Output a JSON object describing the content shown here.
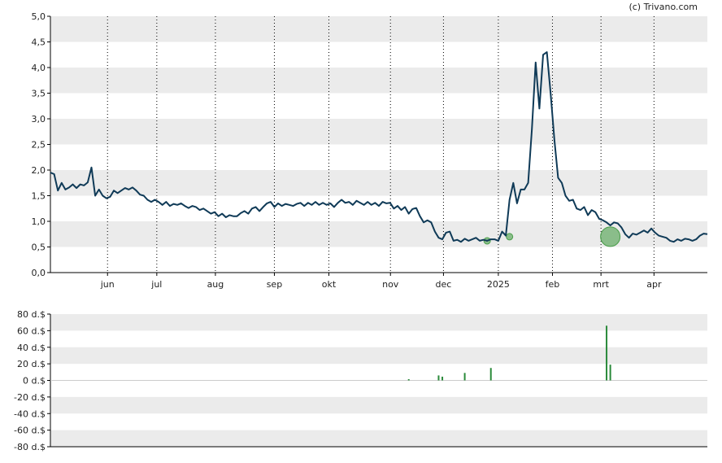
{
  "copyright": "(c) Trivano.com",
  "colors": {
    "band": "#ebebeb",
    "price_line": "#0f3a57",
    "marker": "#4a9e4a",
    "volume_bar": "#2a8a3a",
    "axis": "#000000"
  },
  "chart_data": [
    {
      "type": "line",
      "ylim": [
        0,
        5
      ],
      "y_ticks": [
        "0,0",
        "0,5",
        "1,0",
        "1,5",
        "2,0",
        "2,5",
        "3,0",
        "3,5",
        "4,0",
        "4,5",
        "5,0"
      ],
      "x_ticks": [
        "jun",
        "jul",
        "aug",
        "sep",
        "okt",
        "nov",
        "dec",
        "2025",
        "feb",
        "mrt",
        "apr"
      ],
      "grid": "dotted vertical month lines, alternating horizontal bands",
      "series": [
        {
          "values": [
            [
              0,
              1.95
            ],
            [
              1,
              1.92
            ],
            [
              2,
              1.6
            ],
            [
              3,
              1.75
            ],
            [
              4,
              1.62
            ],
            [
              5,
              1.66
            ],
            [
              6,
              1.72
            ],
            [
              7,
              1.65
            ],
            [
              8,
              1.72
            ],
            [
              9,
              1.7
            ],
            [
              10,
              1.76
            ],
            [
              11,
              2.05
            ],
            [
              12,
              1.5
            ],
            [
              13,
              1.62
            ],
            [
              14,
              1.5
            ],
            [
              15,
              1.45
            ],
            [
              16,
              1.48
            ],
            [
              17,
              1.6
            ],
            [
              18,
              1.55
            ],
            [
              19,
              1.6
            ],
            [
              20,
              1.65
            ],
            [
              21,
              1.62
            ],
            [
              22,
              1.66
            ],
            [
              23,
              1.6
            ],
            [
              24,
              1.52
            ],
            [
              25,
              1.5
            ],
            [
              26,
              1.42
            ],
            [
              27,
              1.38
            ],
            [
              28,
              1.42
            ],
            [
              29,
              1.38
            ],
            [
              30,
              1.32
            ],
            [
              31,
              1.38
            ],
            [
              32,
              1.3
            ],
            [
              33,
              1.34
            ],
            [
              34,
              1.32
            ],
            [
              35,
              1.35
            ],
            [
              36,
              1.3
            ],
            [
              37,
              1.26
            ],
            [
              38,
              1.3
            ],
            [
              39,
              1.28
            ],
            [
              40,
              1.22
            ],
            [
              41,
              1.25
            ],
            [
              42,
              1.2
            ],
            [
              43,
              1.15
            ],
            [
              44,
              1.18
            ],
            [
              45,
              1.1
            ],
            [
              46,
              1.15
            ],
            [
              47,
              1.08
            ],
            [
              48,
              1.12
            ],
            [
              49,
              1.1
            ],
            [
              50,
              1.1
            ],
            [
              51,
              1.16
            ],
            [
              52,
              1.2
            ],
            [
              53,
              1.15
            ],
            [
              54,
              1.25
            ],
            [
              55,
              1.28
            ],
            [
              56,
              1.2
            ],
            [
              57,
              1.28
            ],
            [
              58,
              1.35
            ],
            [
              59,
              1.38
            ],
            [
              60,
              1.28
            ],
            [
              61,
              1.35
            ],
            [
              62,
              1.3
            ],
            [
              63,
              1.34
            ],
            [
              64,
              1.32
            ],
            [
              65,
              1.3
            ],
            [
              66,
              1.34
            ],
            [
              67,
              1.36
            ],
            [
              68,
              1.3
            ],
            [
              69,
              1.36
            ],
            [
              70,
              1.32
            ],
            [
              71,
              1.38
            ],
            [
              72,
              1.32
            ],
            [
              73,
              1.36
            ],
            [
              74,
              1.32
            ],
            [
              75,
              1.35
            ],
            [
              76,
              1.28
            ],
            [
              77,
              1.36
            ],
            [
              78,
              1.42
            ],
            [
              79,
              1.36
            ],
            [
              80,
              1.38
            ],
            [
              81,
              1.32
            ],
            [
              82,
              1.4
            ],
            [
              83,
              1.36
            ],
            [
              84,
              1.32
            ],
            [
              85,
              1.38
            ],
            [
              86,
              1.32
            ],
            [
              87,
              1.36
            ],
            [
              88,
              1.3
            ],
            [
              89,
              1.38
            ],
            [
              90,
              1.35
            ],
            [
              91,
              1.36
            ],
            [
              92,
              1.25
            ],
            [
              93,
              1.3
            ],
            [
              94,
              1.22
            ],
            [
              95,
              1.28
            ],
            [
              96,
              1.15
            ],
            [
              97,
              1.24
            ],
            [
              98,
              1.26
            ],
            [
              99,
              1.1
            ],
            [
              100,
              0.98
            ],
            [
              101,
              1.02
            ],
            [
              102,
              0.98
            ],
            [
              103,
              0.8
            ],
            [
              104,
              0.68
            ],
            [
              105,
              0.65
            ],
            [
              106,
              0.78
            ],
            [
              107,
              0.8
            ],
            [
              108,
              0.62
            ],
            [
              109,
              0.64
            ],
            [
              110,
              0.6
            ],
            [
              111,
              0.66
            ],
            [
              112,
              0.62
            ],
            [
              113,
              0.65
            ],
            [
              114,
              0.68
            ],
            [
              115,
              0.62
            ],
            [
              116,
              0.64
            ],
            [
              117,
              0.62
            ],
            [
              118,
              0.65
            ],
            [
              119,
              0.65
            ],
            [
              120,
              0.62
            ],
            [
              121,
              0.8
            ],
            [
              122,
              0.72
            ],
            [
              123,
              1.42
            ],
            [
              124,
              1.75
            ],
            [
              125,
              1.35
            ],
            [
              126,
              1.62
            ],
            [
              127,
              1.62
            ],
            [
              128,
              1.75
            ],
            [
              129,
              2.8
            ],
            [
              130,
              4.1
            ],
            [
              131,
              3.2
            ],
            [
              132,
              4.25
            ],
            [
              133,
              4.3
            ],
            [
              134,
              3.5
            ],
            [
              135,
              2.6
            ],
            [
              136,
              1.85
            ],
            [
              137,
              1.75
            ],
            [
              138,
              1.5
            ],
            [
              139,
              1.4
            ],
            [
              140,
              1.42
            ],
            [
              141,
              1.25
            ],
            [
              142,
              1.22
            ],
            [
              143,
              1.28
            ],
            [
              144,
              1.12
            ],
            [
              145,
              1.22
            ],
            [
              146,
              1.18
            ],
            [
              147,
              1.05
            ],
            [
              148,
              1.02
            ],
            [
              149,
              0.98
            ],
            [
              150,
              0.92
            ],
            [
              151,
              0.98
            ],
            [
              152,
              0.96
            ],
            [
              153,
              0.88
            ],
            [
              154,
              0.75
            ],
            [
              155,
              0.68
            ],
            [
              156,
              0.76
            ],
            [
              157,
              0.74
            ],
            [
              158,
              0.78
            ],
            [
              159,
              0.82
            ],
            [
              160,
              0.78
            ],
            [
              161,
              0.86
            ],
            [
              162,
              0.78
            ],
            [
              163,
              0.72
            ],
            [
              164,
              0.7
            ],
            [
              165,
              0.68
            ],
            [
              166,
              0.62
            ],
            [
              167,
              0.6
            ],
            [
              168,
              0.65
            ],
            [
              169,
              0.62
            ],
            [
              170,
              0.66
            ],
            [
              171,
              0.65
            ],
            [
              172,
              0.62
            ],
            [
              173,
              0.65
            ],
            [
              174,
              0.72
            ],
            [
              175,
              0.76
            ],
            [
              176,
              0.75
            ]
          ]
        }
      ],
      "markers": [
        {
          "x": 117,
          "y": 0.62,
          "size": "small"
        },
        {
          "x": 123,
          "y": 0.7,
          "size": "small"
        },
        {
          "x": 150,
          "y": 0.7,
          "size": "large"
        }
      ],
      "x_range": [
        0,
        176
      ],
      "x_tick_positions": [
        15.3,
        28.5,
        44.2,
        60.0,
        74.6,
        91.1,
        105.3,
        120.0,
        134.5,
        147.5,
        161.7
      ]
    },
    {
      "type": "bar",
      "ylim": [
        -80,
        80
      ],
      "y_ticks": [
        "-80 d.$",
        "-60 d.$",
        "-40 d.$",
        "-20 d.$",
        "0 d.$",
        "20 d.$",
        "40 d.$",
        "60 d.$",
        "80 d.$"
      ],
      "bars": [
        {
          "x": 96,
          "value": 1.5
        },
        {
          "x": 104,
          "value": 6
        },
        {
          "x": 105,
          "value": 4.5
        },
        {
          "x": 111,
          "value": 9
        },
        {
          "x": 118,
          "value": 15
        },
        {
          "x": 149,
          "value": 66
        },
        {
          "x": 150,
          "value": 19
        }
      ]
    }
  ]
}
